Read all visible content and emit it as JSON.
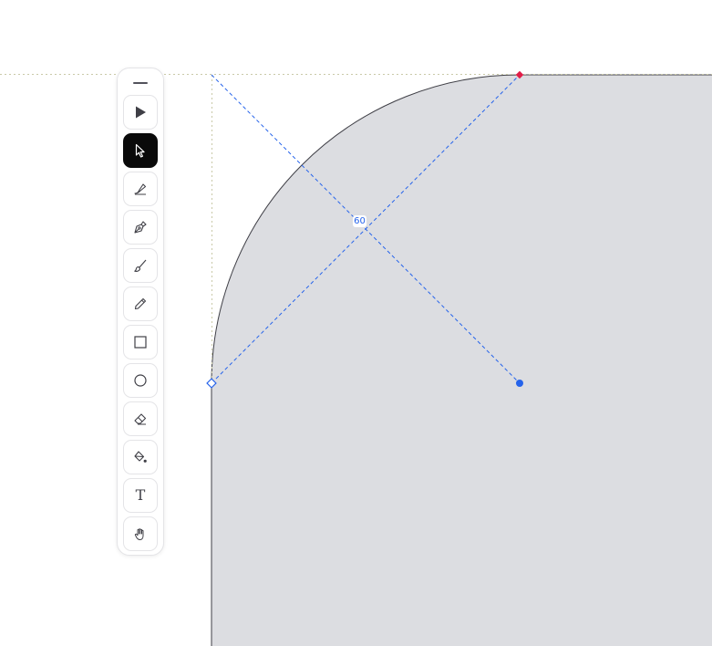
{
  "toolbar": {
    "tools": [
      {
        "name": "select-filled",
        "icon": "arrow-filled-icon",
        "active": false
      },
      {
        "name": "select",
        "icon": "cursor-arrow-icon",
        "active": true
      },
      {
        "name": "calligraphy",
        "icon": "nib-icon",
        "active": false
      },
      {
        "name": "pen",
        "icon": "pen-tool-icon",
        "active": false
      },
      {
        "name": "brush",
        "icon": "brush-icon",
        "active": false
      },
      {
        "name": "pencil",
        "icon": "pencil-icon",
        "active": false
      },
      {
        "name": "rectangle",
        "icon": "square-icon",
        "active": false
      },
      {
        "name": "ellipse",
        "icon": "circle-icon",
        "active": false
      },
      {
        "name": "eraser",
        "icon": "eraser-icon",
        "active": false
      },
      {
        "name": "fill",
        "icon": "paint-bucket-icon",
        "active": false
      },
      {
        "name": "text",
        "icon": "text-icon",
        "label": "T",
        "active": false
      },
      {
        "name": "hand",
        "icon": "hand-icon",
        "active": false
      }
    ]
  },
  "canvas": {
    "corner_angle_label": "60",
    "colors": {
      "shape_fill": "#dcdde1",
      "shape_stroke": "#3f3f46",
      "guide_blue": "#2563eb",
      "guide_gray": "#c9c9a8",
      "handle_red": "#e11d48",
      "active_tool_bg": "#0a0a0a"
    }
  }
}
